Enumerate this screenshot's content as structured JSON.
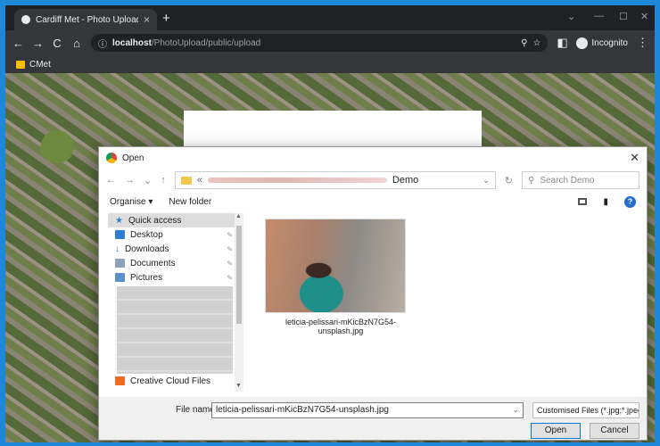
{
  "browser": {
    "tab_title": "Cardiff Met - Photo Upload",
    "tab_close": "×",
    "new_tab": "+",
    "window_controls": [
      "⌄",
      "—",
      "☐",
      "✕"
    ],
    "back": "←",
    "forward": "→",
    "reload": "C",
    "home": "⌂",
    "info": "ⓘ",
    "url_host": "localhost",
    "url_path": "/PhotoUpload/public/upload",
    "zoom_icon": "⚲",
    "star_icon": "☆",
    "incognito_label": "Incognito",
    "menu": "⋮"
  },
  "bookmarks": [
    {
      "label": "CMet"
    }
  ],
  "dialog": {
    "title": "Open",
    "close": "✕",
    "nav_back": "←",
    "nav_forward": "→",
    "nav_recent": "⌄",
    "nav_up": "↑",
    "breadcrumb_prefix": "«",
    "breadcrumb_last": "Demo",
    "breadcrumb_dropdown": "⌄",
    "refresh": "↻",
    "search_placeholder": "Search Demo",
    "organise": "Organise ▾",
    "new_folder": "New folder",
    "help": "?",
    "nav_items": [
      {
        "label": "Quick access",
        "color": "#3b8fe0"
      },
      {
        "label": "Desktop",
        "color": "#2d7fd3"
      },
      {
        "label": "Downloads",
        "color": "#2d7fd3"
      },
      {
        "label": "Documents",
        "color": "#8aa2bb"
      },
      {
        "label": "Pictures",
        "color": "#5b8fc7"
      }
    ],
    "creative_cloud": "Creative Cloud Files",
    "file_name": "leticia-pelissari-mKicBzN7G54-unsplash.jpg",
    "file_name_label": "File name:",
    "file_name_value": "leticia-pelissari-mKicBzN7G54-unsplash.jpg",
    "file_type": "Customised Files (*.jpg;*.jpeg;*.",
    "open_label": "Open",
    "cancel_label": "Cancel"
  }
}
